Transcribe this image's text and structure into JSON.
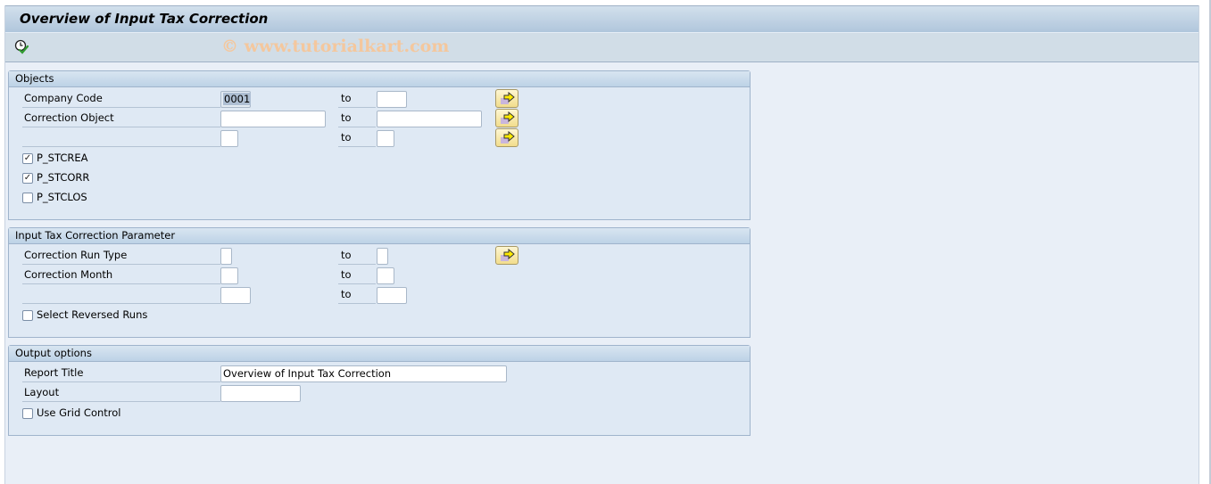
{
  "window": {
    "title": "Overview of Input Tax Correction",
    "watermark": "© www.tutorialkart.com"
  },
  "toolbar": {
    "execute_icon": "execute-clock-check-icon"
  },
  "objects": {
    "header": "Objects",
    "company_code": {
      "label": "Company Code",
      "from": "0001",
      "to_label": "to",
      "to": ""
    },
    "correction_object": {
      "label": "Correction Object",
      "from": "",
      "to_label": "to",
      "to": ""
    },
    "unnamed_range": {
      "label": "",
      "from": "",
      "to_label": "to",
      "to": ""
    },
    "checkboxes": [
      {
        "label": "P_STCREA",
        "checked": true
      },
      {
        "label": "P_STCORR",
        "checked": true
      },
      {
        "label": "P_STCLOS",
        "checked": false
      }
    ]
  },
  "params": {
    "header": "Input Tax Correction Parameter",
    "run_type": {
      "label": "Correction Run Type",
      "from": "",
      "to_label": "to",
      "to": ""
    },
    "month": {
      "label": "Correction Month",
      "from": "",
      "to_label": "to",
      "to": ""
    },
    "unnamed_range": {
      "label": "",
      "from": "",
      "to_label": "to",
      "to": ""
    },
    "reversed": {
      "label": "Select Reversed Runs",
      "checked": false
    }
  },
  "output": {
    "header": "Output options",
    "report_title": {
      "label": "Report Title",
      "value": "Overview of Input Tax Correction"
    },
    "layout": {
      "label": "Layout",
      "value": ""
    },
    "grid": {
      "label": "Use Grid Control",
      "checked": false
    }
  },
  "icons": {
    "multiple_selection": "multiple-selection-arrow-icon",
    "check_mark": "✓"
  }
}
